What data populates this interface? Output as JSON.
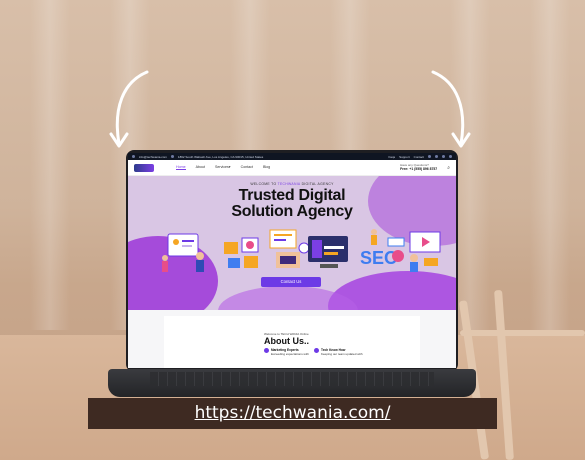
{
  "url_caption": "https://techwania.com/",
  "site": {
    "topbar": {
      "email": "info@techwania.com",
      "address": "1862 South Wabash Ave, Los Angeles, CA 90015, United States",
      "links": [
        "Faqs",
        "Support",
        "Contact"
      ]
    },
    "nav": {
      "logo_text": "TechWania",
      "items": [
        "Home",
        "About",
        "Services",
        "Contact",
        "Blog"
      ],
      "active_item": "Home",
      "call_label": "Have any Questions?",
      "call_number": "Free: +1 (555) 896 8757"
    },
    "hero": {
      "kicker_prefix": "WELCOME TO",
      "kicker_brand": "TECHWANIA",
      "kicker_suffix": "DIGITAL AGENCY",
      "title_line1": "Trusted Digital",
      "title_line2": "Solution Agency",
      "cta": "Contact Us"
    },
    "about": {
      "kicker": "Welcome to TECH WANIA Online",
      "title": "About Us..",
      "features": [
        {
          "title": "Marketing Experts",
          "text": "Exceeding expectations with"
        },
        {
          "title": "Tech Know How",
          "text": "Keeping our team updated with"
        }
      ]
    }
  },
  "colors": {
    "accent": "#6d3ae6",
    "hero_bg": "#d9c6e4",
    "caption_band": "#3e2a22"
  }
}
